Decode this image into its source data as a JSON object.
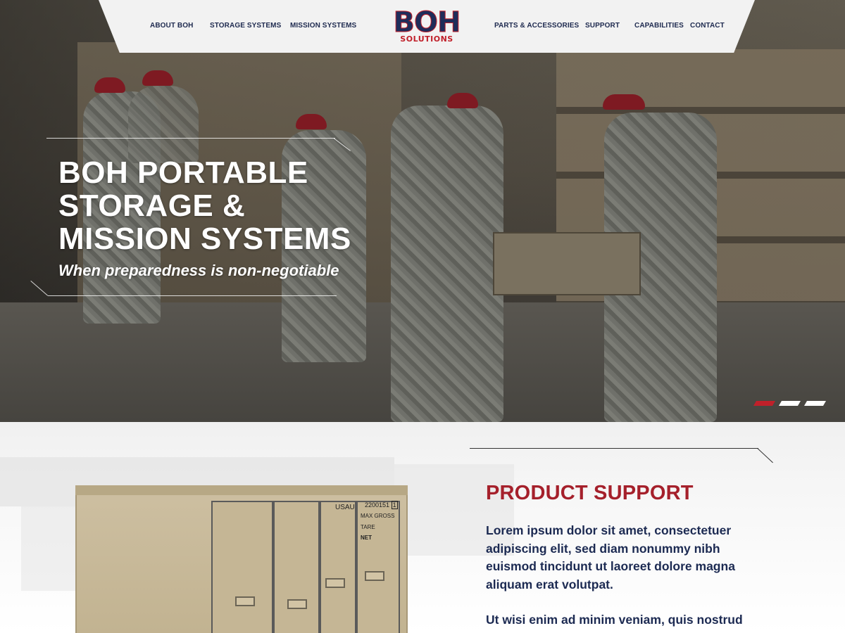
{
  "nav": {
    "items_left": [
      {
        "label": "ABOUT BOH"
      },
      {
        "label": "STORAGE SYSTEMS"
      },
      {
        "label": "MISSION SYSTEMS"
      }
    ],
    "items_right": [
      {
        "label": "PARTS & ACCESSORIES"
      },
      {
        "label": "SUPPORT"
      },
      {
        "label": "CAPABILITIES"
      },
      {
        "label": "CONTACT"
      }
    ],
    "logo": {
      "main": "BOH",
      "sub": "SOLUTIONS"
    }
  },
  "hero": {
    "title_line1": "BOH PORTABLE",
    "title_line2": "STORAGE &",
    "title_line3": "MISSION SYSTEMS",
    "tagline": "When preparedness is non-negotiable",
    "slider": {
      "count": 3,
      "active_index": 0,
      "colors": {
        "active": "#c0202a",
        "inactive": "#ffffff"
      }
    }
  },
  "product_support": {
    "title": "PRODUCT SUPPORT",
    "paragraph1": "Lorem ipsum dolor sit amet, consectetuer adipiscing elit, sed diam nonummy nibh euismod tincidunt ut laoreet dolore magna aliquam erat volutpat.",
    "paragraph2": "Ut wisi enim ad minim veniam, quis nostrud exerci tation ullamcorper suscipit lobortis"
  },
  "container_markings": {
    "usau": "USAU",
    "serial": "2200151",
    "check_digit": "1",
    "max_gross": "MAX GROSS",
    "tare": "TARE",
    "net": "NET"
  },
  "colors": {
    "navy": "#1c2a52",
    "brand_red": "#a5202b",
    "nav_bg": "#f2f2f2"
  }
}
